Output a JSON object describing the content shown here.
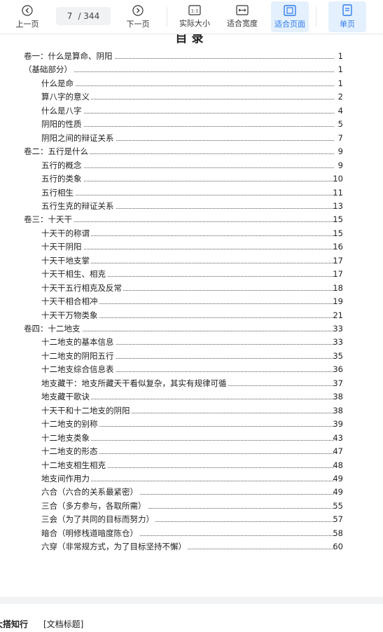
{
  "toolbar": {
    "prev_label": "上一页",
    "next_label": "下一页",
    "current_page": "7",
    "total_pages": "/ 344",
    "actual_size_label": "实际大小",
    "fit_width_label": "适合宽度",
    "fit_page_label": "适合页面",
    "single_page_label": "单页"
  },
  "document": {
    "toc_title": "目录",
    "toc": [
      {
        "label": "卷一：什么是算命、阴阳",
        "page": "1",
        "level": 0
      },
      {
        "label": "（基础部分）",
        "page": "1",
        "level": 0
      },
      {
        "label": "什么是命",
        "page": "1",
        "level": 1
      },
      {
        "label": "算八字的意义",
        "page": "2",
        "level": 1
      },
      {
        "label": "什么是八字",
        "page": "4",
        "level": 1
      },
      {
        "label": "阴阳的性质",
        "page": "5",
        "level": 1
      },
      {
        "label": "阴阳之间的辩证关系",
        "page": "7",
        "level": 1
      },
      {
        "label": "卷二：五行是什么",
        "page": "9",
        "level": 0
      },
      {
        "label": "五行的概念",
        "page": "9",
        "level": 1
      },
      {
        "label": "五行的类象",
        "page": "10",
        "level": 1
      },
      {
        "label": "五行相生",
        "page": "11",
        "level": 1
      },
      {
        "label": "五行生克的辩证关系",
        "page": "13",
        "level": 1
      },
      {
        "label": "卷三：十天干",
        "page": "15",
        "level": 0
      },
      {
        "label": "十天干的称谓",
        "page": "15",
        "level": 1
      },
      {
        "label": "十天干阴阳",
        "page": "16",
        "level": 1
      },
      {
        "label": "十天干地支掌",
        "page": "17",
        "level": 1
      },
      {
        "label": "十天干相生、相克",
        "page": "17",
        "level": 1
      },
      {
        "label": "十天干五行相克及反常",
        "page": "18",
        "level": 1
      },
      {
        "label": "十天干相合相冲",
        "page": "19",
        "level": 1
      },
      {
        "label": "十天干万物类象",
        "page": "21",
        "level": 1
      },
      {
        "label": "卷四：十二地支",
        "page": "33",
        "level": 0
      },
      {
        "label": "十二地支的基本信息",
        "page": "33",
        "level": 1
      },
      {
        "label": "十二地支的阴阳五行",
        "page": "35",
        "level": 1
      },
      {
        "label": "十二地支综合信息表",
        "page": "36",
        "level": 1
      },
      {
        "label": "地支藏干：地支所藏天干看似复杂，其实有规律可循",
        "page": "37",
        "level": 1
      },
      {
        "label": "地支藏干歌诀",
        "page": "38",
        "level": 1
      },
      {
        "label": "十天干和十二地支的阴阳",
        "page": "38",
        "level": 1
      },
      {
        "label": "十二地支的别称",
        "page": "39",
        "level": 1
      },
      {
        "label": "十二地支类象",
        "page": "43",
        "level": 1
      },
      {
        "label": "十二地支的形态",
        "page": "47",
        "level": 1
      },
      {
        "label": "十二地支相生相克",
        "page": "48",
        "level": 1
      },
      {
        "label": "地支间作用力",
        "page": "49",
        "level": 1
      },
      {
        "label": "六合（六合的关系最紧密）",
        "page": "49",
        "level": 1
      },
      {
        "label": "三合（多方参与，各取所需）",
        "page": "55",
        "level": 1
      },
      {
        "label": "三会（为了共同的目标而努力）",
        "page": "57",
        "level": 1
      },
      {
        "label": "暗合（明修栈道暗度陈仓）",
        "page": "58",
        "level": 1
      },
      {
        "label": "六穿（非常规方式，为了目标坚持不懈）",
        "page": "60",
        "level": 1
      }
    ]
  },
  "next_page": {
    "brand": "大搭知行",
    "doc_title": "[文档标题]"
  },
  "colors": {
    "accent": "#2f7bef",
    "active_bg": "#e4f0fd"
  }
}
